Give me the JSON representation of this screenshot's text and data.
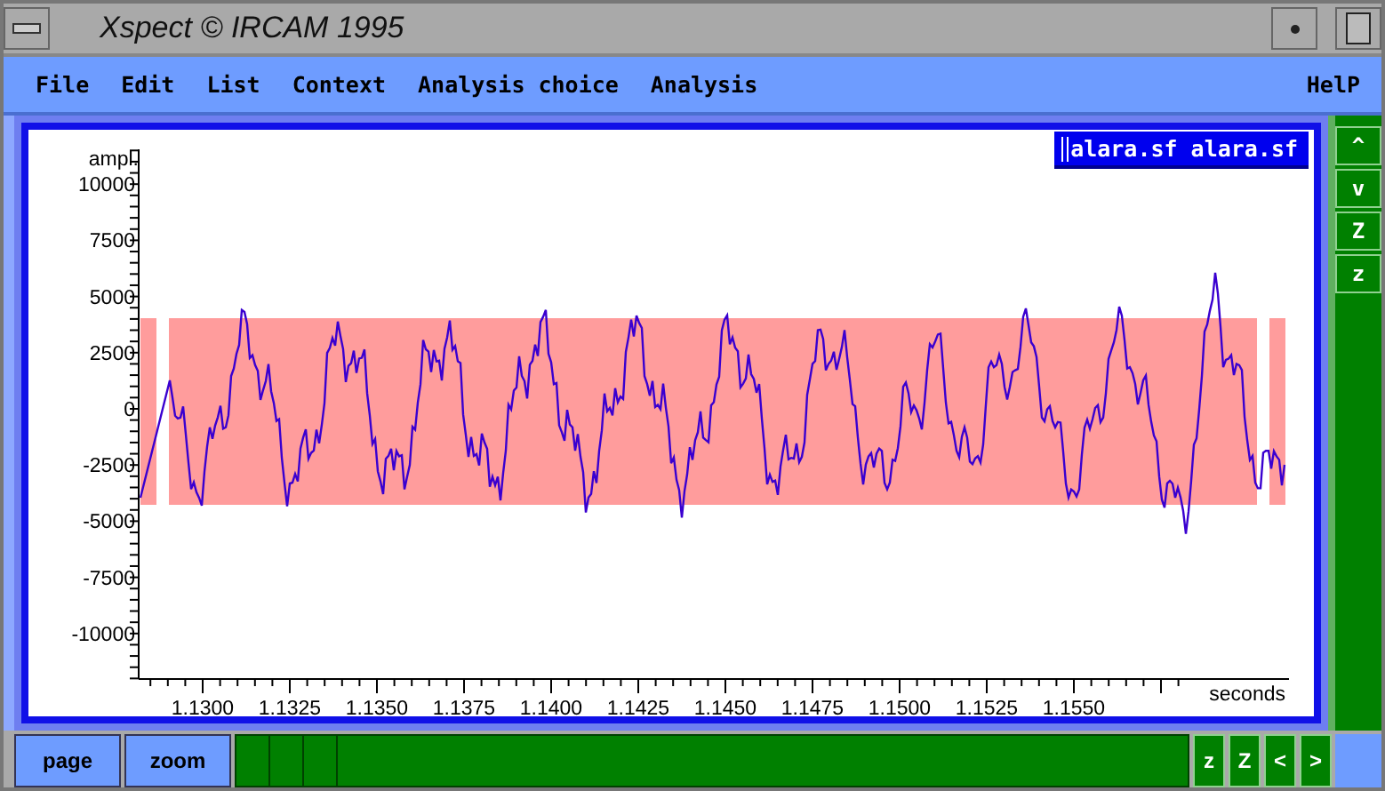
{
  "window": {
    "title": "Xspect © IRCAM 1995"
  },
  "menu": [
    "File",
    "Edit",
    "List",
    "Context",
    "Analysis choice",
    "Analysis"
  ],
  "help": "HelP",
  "file_label": "alara.sf alara.sf",
  "side_buttons": [
    "^",
    "v",
    "Z",
    "z"
  ],
  "plot": {
    "ylabel": "ampl.",
    "xlabel": "seconds",
    "yticks": [
      "10000",
      "7500",
      "5000",
      "2500",
      "0",
      "-2500",
      "-5000",
      "-7500",
      "-10000"
    ],
    "xticks": [
      "1.1300",
      "1.1325",
      "1.1350",
      "1.1375",
      "1.1400",
      "1.1425",
      "1.1450",
      "1.1475",
      "1.1500",
      "1.1525",
      "1.1550"
    ]
  },
  "bottom": {
    "buttons": [
      "page",
      "zoom"
    ],
    "nav_buttons": [
      "z",
      "Z",
      "<",
      ">"
    ]
  }
}
